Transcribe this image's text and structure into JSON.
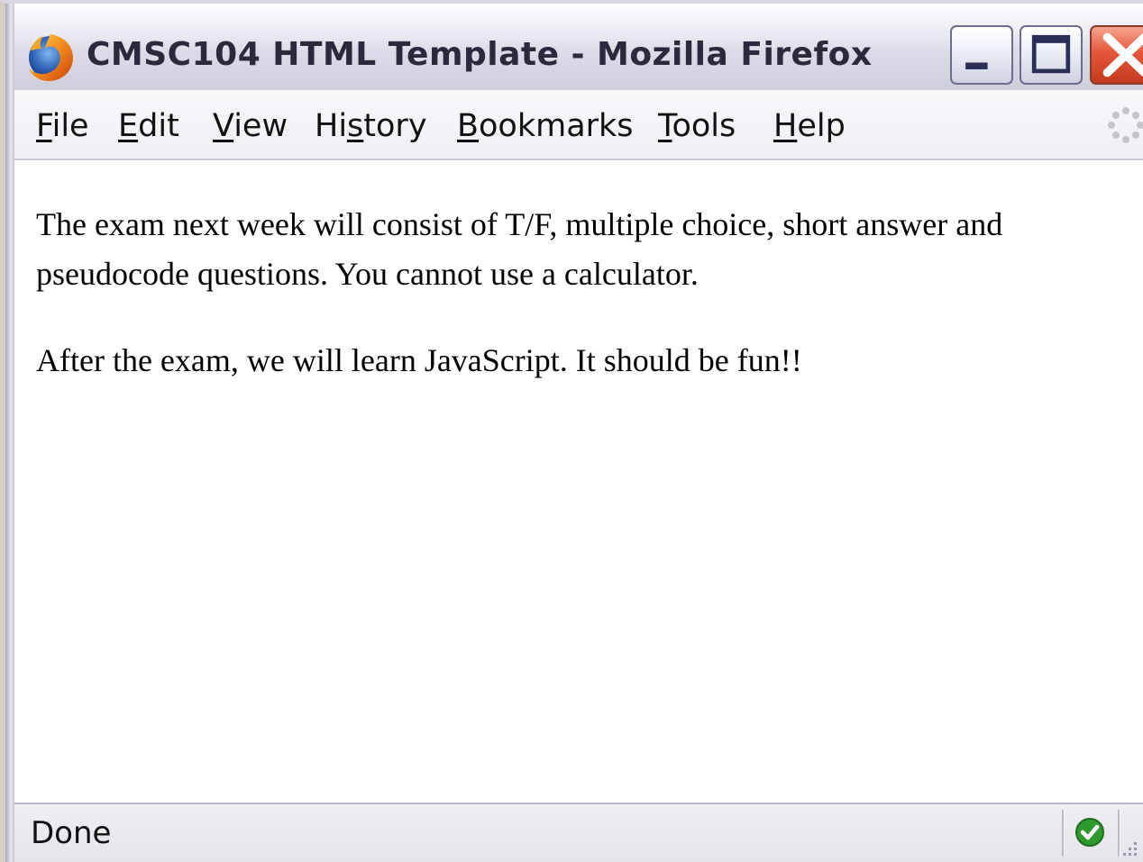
{
  "window": {
    "title": "CMSC104 HTML Template - Mozilla Firefox"
  },
  "menu": {
    "items": [
      {
        "before": "",
        "key": "F",
        "after": "ile"
      },
      {
        "before": "",
        "key": "E",
        "after": "dit"
      },
      {
        "before": "",
        "key": "V",
        "after": "iew"
      },
      {
        "before": "Hi",
        "key": "s",
        "after": "tory"
      },
      {
        "before": "",
        "key": "B",
        "after": "ookmarks"
      },
      {
        "before": "",
        "key": "T",
        "after": "ools"
      },
      {
        "before": "",
        "key": "H",
        "after": "elp"
      }
    ]
  },
  "content": {
    "paragraph1": "The exam next week will consist of T/F, multiple choice, short answer and pseudocode questions. You cannot use a calculator.",
    "paragraph2": "After the exam, we will learn JavaScript. It should be fun!!"
  },
  "status": {
    "text": "Done"
  },
  "icons": {
    "app": "firefox-icon",
    "minimize": "minimize-icon",
    "maximize": "maximize-icon",
    "close": "close-icon",
    "throbber": "throbber-icon",
    "secure": "check-icon",
    "grip": "resize-grip-icon"
  },
  "colors": {
    "close_button": "#e5573a",
    "secure_green": "#2e9a2e"
  }
}
